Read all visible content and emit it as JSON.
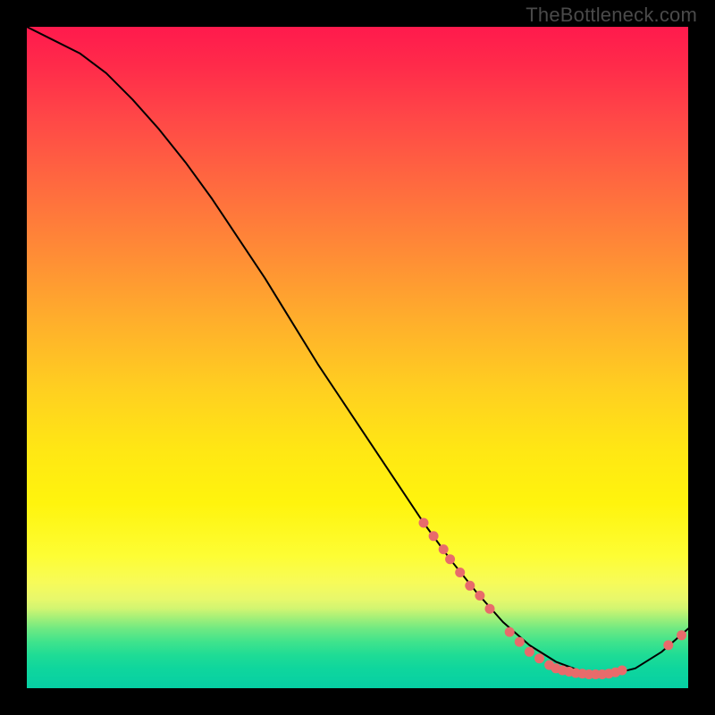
{
  "watermark": "TheBottleneck.com",
  "colors": {
    "marker": "#e86b6b",
    "curve": "#000000"
  },
  "chart_data": {
    "type": "line",
    "title": "",
    "xlabel": "",
    "ylabel": "",
    "xlim": [
      0,
      100
    ],
    "ylim": [
      0,
      100
    ],
    "grid": false,
    "note": "No numeric axis ticks are visible; x and y are inferred as 0–100 percent of the plot area. y=0 is the bottom (teal-green) edge. Curve starts near the top-left, descends roughly linearly, reaches a broad minimum basin around x≈78–90, then rises toward the right edge.",
    "series": [
      {
        "name": "curve",
        "x": [
          0,
          4,
          8,
          12,
          16,
          20,
          24,
          28,
          32,
          36,
          40,
          44,
          48,
          52,
          56,
          60,
          64,
          68,
          72,
          76,
          80,
          84,
          88,
          92,
          96,
          100
        ],
        "y": [
          100,
          98,
          96,
          93,
          89,
          84.5,
          79.5,
          74,
          68,
          62,
          55.5,
          49,
          43,
          37,
          31,
          25,
          19.5,
          14.5,
          10,
          6.5,
          4,
          2.5,
          2,
          3,
          5.5,
          9
        ]
      }
    ],
    "markers": {
      "name": "scatter-points",
      "note": "Salmon-colored points overlaid on/near the curve, clustered mid-right and lower-right.",
      "points": [
        {
          "x": 60,
          "y": 25
        },
        {
          "x": 61.5,
          "y": 23
        },
        {
          "x": 63,
          "y": 21
        },
        {
          "x": 64,
          "y": 19.5
        },
        {
          "x": 65.5,
          "y": 17.5
        },
        {
          "x": 67,
          "y": 15.5
        },
        {
          "x": 68.5,
          "y": 14
        },
        {
          "x": 70,
          "y": 12
        },
        {
          "x": 73,
          "y": 8.5
        },
        {
          "x": 74.5,
          "y": 7
        },
        {
          "x": 76,
          "y": 5.5
        },
        {
          "x": 77.5,
          "y": 4.5
        },
        {
          "x": 79,
          "y": 3.5
        },
        {
          "x": 80,
          "y": 3
        },
        {
          "x": 81,
          "y": 2.7
        },
        {
          "x": 82,
          "y": 2.5
        },
        {
          "x": 83,
          "y": 2.3
        },
        {
          "x": 84,
          "y": 2.2
        },
        {
          "x": 85,
          "y": 2.1
        },
        {
          "x": 86,
          "y": 2.1
        },
        {
          "x": 87,
          "y": 2.1
        },
        {
          "x": 88,
          "y": 2.2
        },
        {
          "x": 89,
          "y": 2.4
        },
        {
          "x": 90,
          "y": 2.7
        },
        {
          "x": 97,
          "y": 6.5
        },
        {
          "x": 99,
          "y": 8
        }
      ]
    }
  }
}
